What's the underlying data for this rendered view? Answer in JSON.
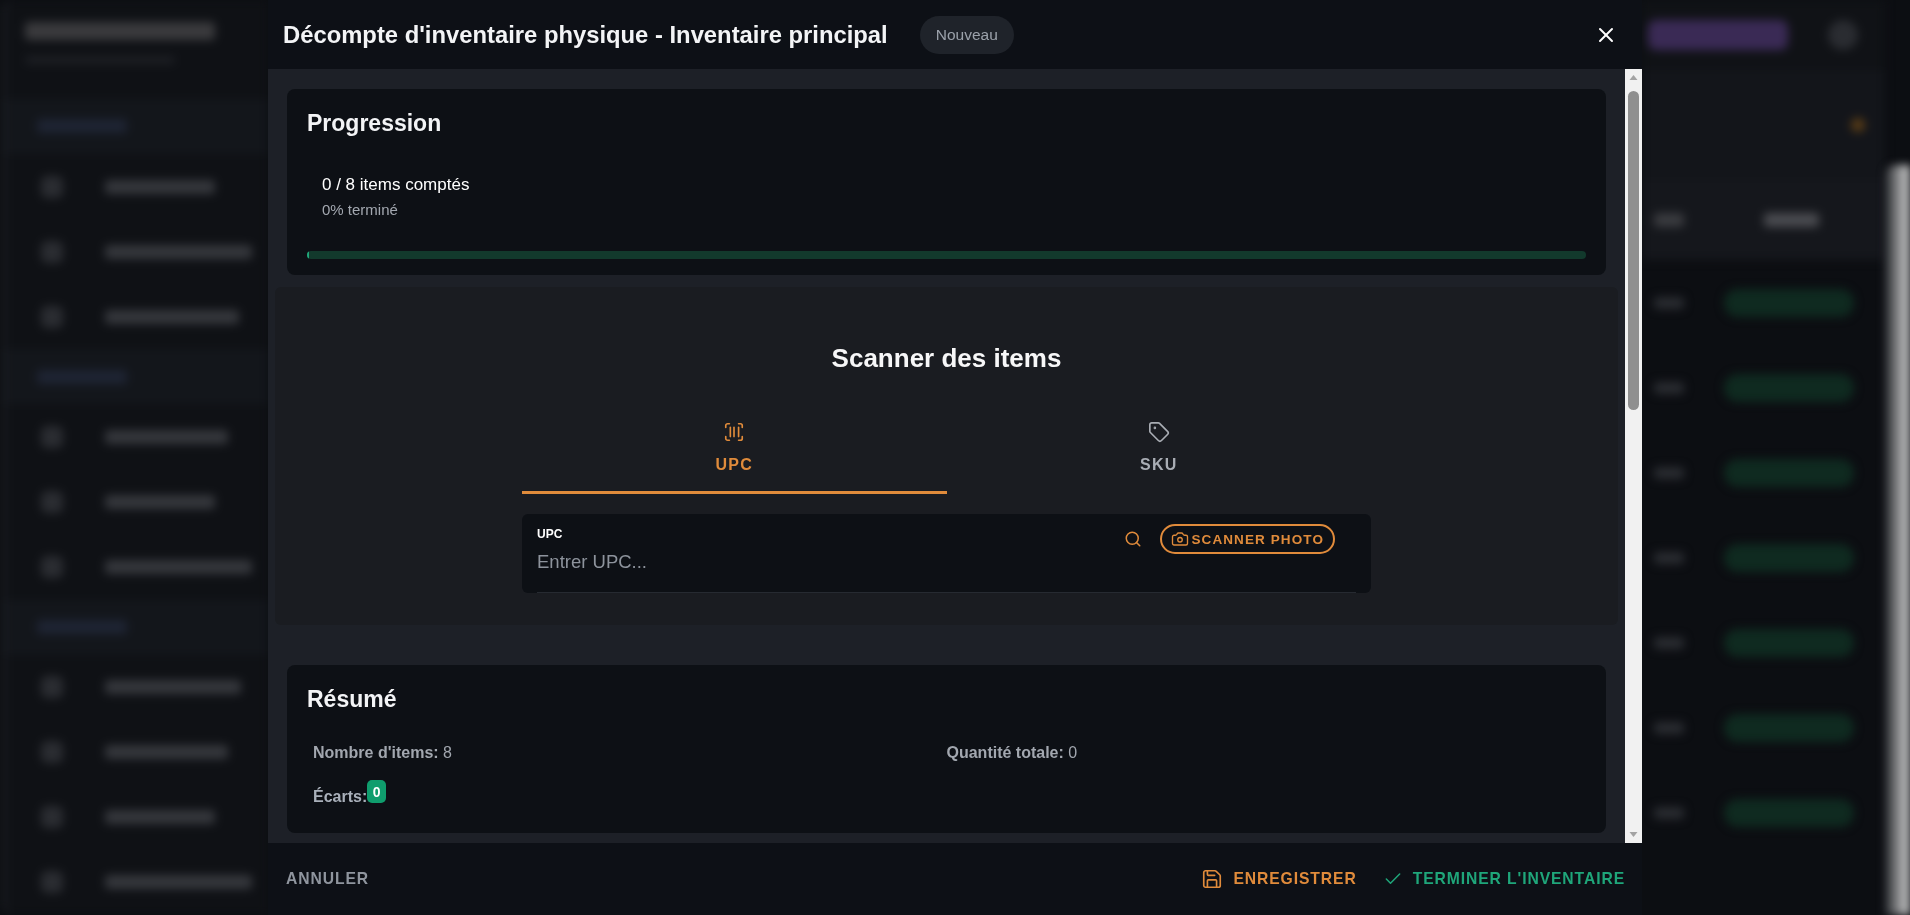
{
  "dialog": {
    "title": "Décompte d'inventaire physique - Inventaire principal",
    "status_badge": "Nouveau"
  },
  "progress": {
    "title": "Progression",
    "count_text": "0 / 8 items comptés",
    "percent_text": "0% terminé",
    "level": 0
  },
  "scanner": {
    "title": "Scanner des items",
    "tabs": [
      {
        "label": "UPC",
        "kind": "upc",
        "selected": true
      },
      {
        "label": "SKU",
        "kind": "sku",
        "selected": false
      }
    ],
    "field": {
      "label": "UPC",
      "placeholder": "Entrer UPC..."
    },
    "photo_button": "SCANNER PHOTO"
  },
  "summary": {
    "title": "Résumé",
    "stats": [
      "**Nombre d'items:** 8",
      "**Quantité totale:** 0"
    ],
    "discrepancies": {
      "label": "Écarts:",
      "count": "0"
    }
  },
  "footer": {
    "buttons": [
      {
        "label": "ANNULER",
        "kind": "cancel"
      },
      {
        "label": "ENREGISTRER",
        "kind": "save"
      },
      {
        "label": "TERMINER L'INVENTAIRE",
        "kind": "finish"
      }
    ]
  }
}
